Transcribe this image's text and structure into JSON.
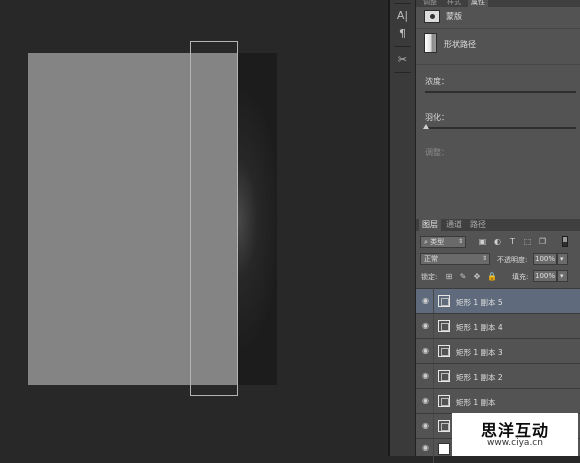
{
  "properties": {
    "tabs": [
      "调整",
      "样式",
      "属性"
    ],
    "mask_label": "蒙版",
    "vector_mask_label": "形状路径",
    "density_label": "浓度：",
    "feather_label": "羽化：",
    "adjust_label": "调整："
  },
  "tool_dock": {
    "icons": [
      "character-icon",
      "paragraph-icon",
      "tools-icon"
    ]
  },
  "layers": {
    "tabs": [
      "图层",
      "通道",
      "路径"
    ],
    "filter_kind": "类型",
    "blend_mode": "正常",
    "opacity_label": "不透明度:",
    "opacity_value": "100%",
    "lock_label": "锁定:",
    "fill_label": "填充:",
    "fill_value": "100%",
    "rows": [
      {
        "name": "矩形 1 副本 5",
        "selected": true
      },
      {
        "name": "矩形 1 副本 4",
        "selected": false
      },
      {
        "name": "矩形 1 副本 3",
        "selected": false
      },
      {
        "name": "矩形 1 副本 2",
        "selected": false
      },
      {
        "name": "矩形 1 副本",
        "selected": false
      },
      {
        "name": "",
        "selected": false
      }
    ]
  },
  "watermark": {
    "title": "思洋互动",
    "url": "www.ciya.cn"
  },
  "colors": {
    "canvas_bg": "#282828",
    "panel_bg": "#535353",
    "selected_row": "#5f6b7c",
    "shape_fill": "#848484"
  }
}
